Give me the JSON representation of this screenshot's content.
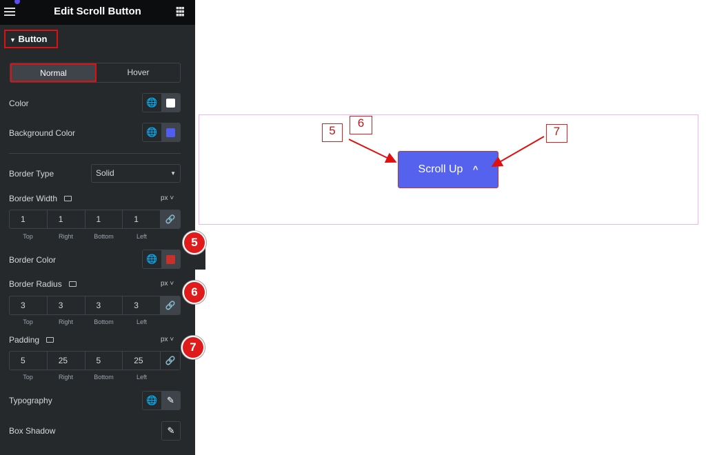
{
  "header": {
    "title": "Edit Scroll Button"
  },
  "section": {
    "title": "Button"
  },
  "tabs": [
    {
      "label": "Normal",
      "active": true
    },
    {
      "label": "Hover",
      "active": false
    }
  ],
  "controls": {
    "color": {
      "label": "Color",
      "value": "#ffffff"
    },
    "background_color": {
      "label": "Background Color",
      "value": "#4f5ef0"
    },
    "border_type": {
      "label": "Border Type",
      "value": "Solid"
    },
    "border_width": {
      "label": "Border Width",
      "unit": "px",
      "values": [
        "1",
        "1",
        "1",
        "1"
      ]
    },
    "border_color": {
      "label": "Border Color",
      "value": "#c8302a"
    },
    "border_radius": {
      "label": "Border Radius",
      "unit": "px",
      "values": [
        "3",
        "3",
        "3",
        "3"
      ]
    },
    "padding": {
      "label": "Padding",
      "unit": "px",
      "values": [
        "5",
        "25",
        "5",
        "25"
      ]
    },
    "typography": {
      "label": "Typography"
    },
    "box_shadow": {
      "label": "Box Shadow"
    }
  },
  "sides": [
    "Top",
    "Right",
    "Bottom",
    "Left"
  ],
  "preview": {
    "button_label": "Scroll Up",
    "button_color": "#5462ed"
  },
  "annotations": {
    "badges": [
      "5",
      "6",
      "7"
    ],
    "boxes": [
      "5",
      "6",
      "7"
    ]
  }
}
